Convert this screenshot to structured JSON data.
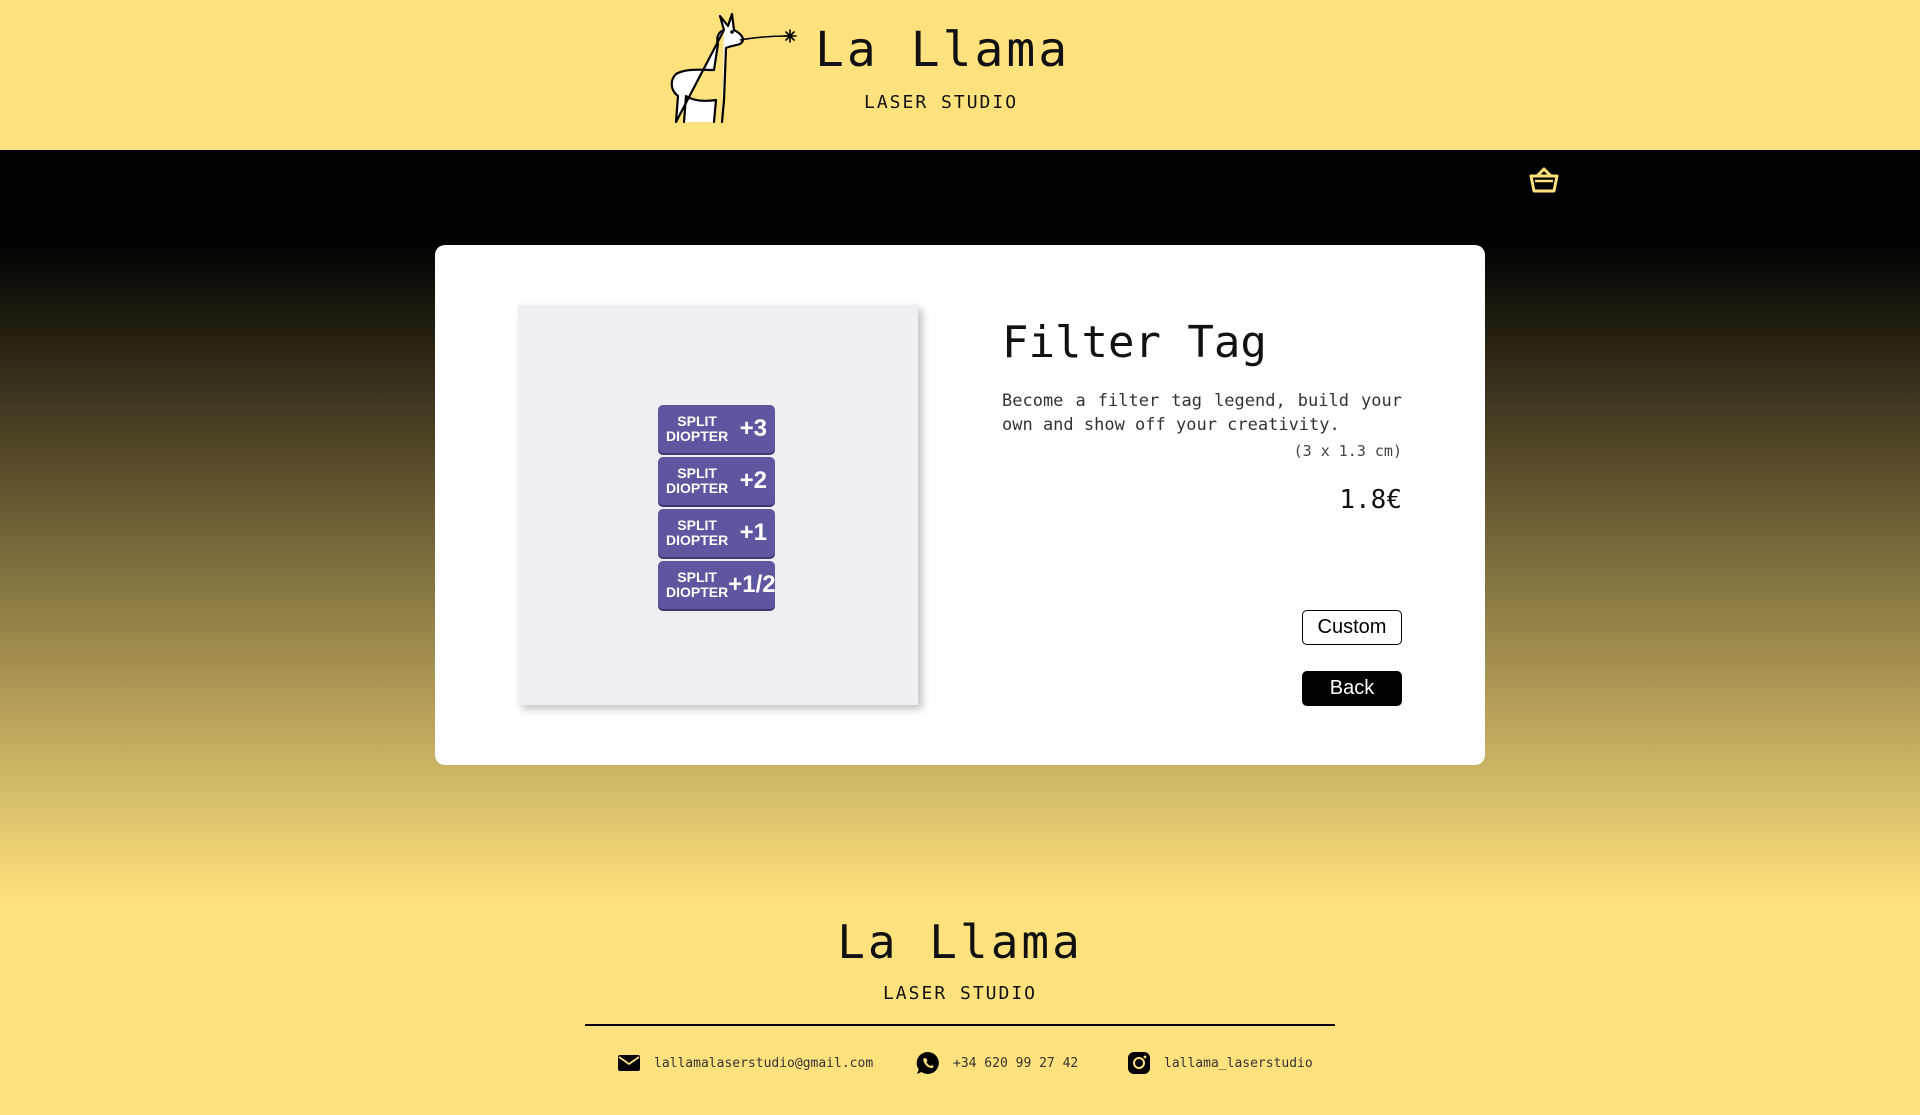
{
  "brand": {
    "name": "La Llama",
    "tagline": "LASER STUDIO"
  },
  "header": {
    "cart_icon": "basket-icon"
  },
  "product": {
    "title": "Filter Tag",
    "description": "Become a filter tag legend, build your own and show off your creativity.",
    "size": "(3 x 1.3 cm)",
    "price": "1.8€",
    "image_tags": [
      {
        "line1": "SPLIT",
        "line2": "DIOPTER",
        "value": "+3"
      },
      {
        "line1": "SPLIT",
        "line2": "DIOPTER",
        "value": "+2"
      },
      {
        "line1": "SPLIT",
        "line2": "DIOPTER",
        "value": "+1"
      },
      {
        "line1": "SPLIT",
        "line2": "DIOPTER",
        "value": "+1/2"
      }
    ]
  },
  "actions": {
    "custom_label": "Custom",
    "back_label": "Back"
  },
  "footer": {
    "name": "La Llama",
    "tagline": "LASER STUDIO",
    "contacts": [
      {
        "icon": "mail-icon",
        "text": "lallamalaserstudio@gmail.com"
      },
      {
        "icon": "whatsapp-icon",
        "text": "+34 620 99 27 42"
      },
      {
        "icon": "instagram-icon",
        "text": "lallama_laserstudio"
      }
    ]
  },
  "colors": {
    "background": "#ffe17d",
    "tag": "#5e569f",
    "dark": "#000000",
    "card": "#ffffff"
  }
}
